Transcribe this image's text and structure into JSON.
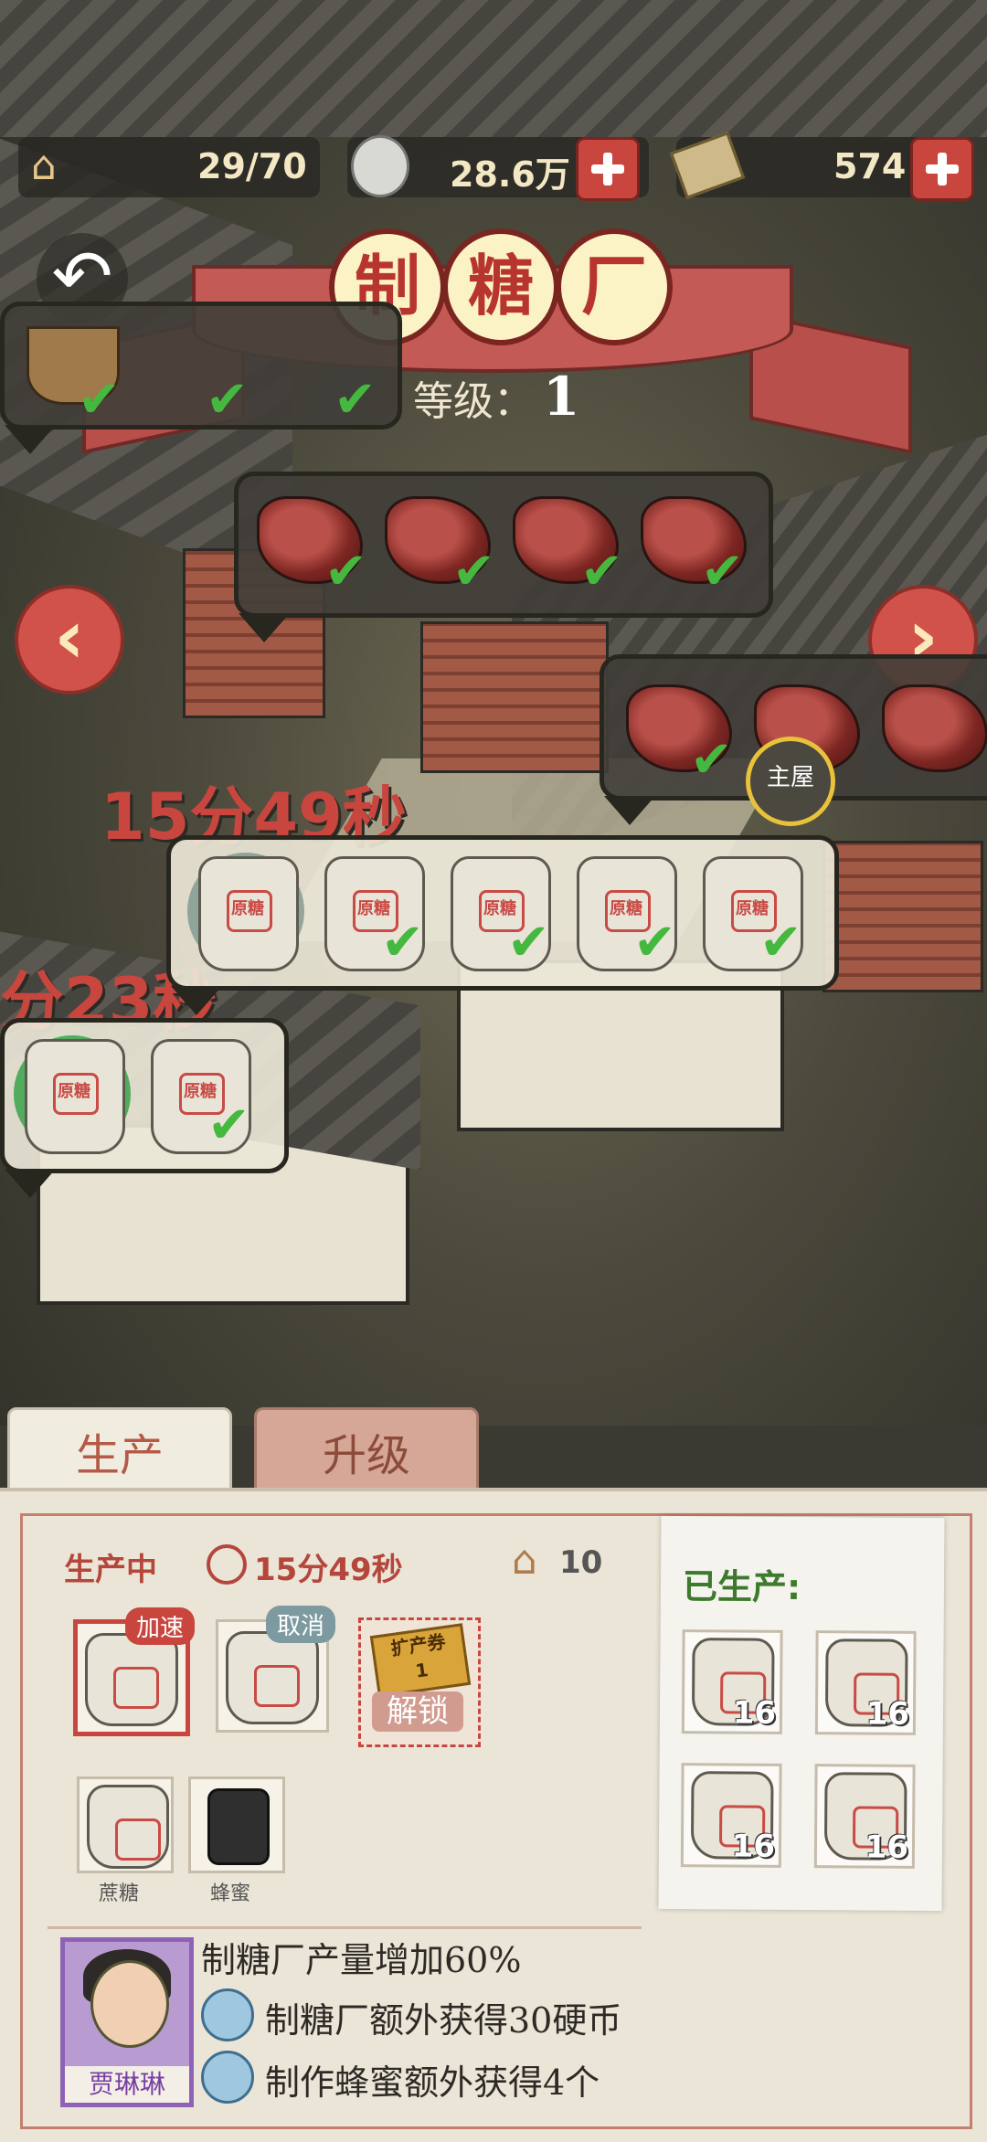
{
  "hud": {
    "energy": "29/70",
    "coins": "28.6万",
    "cash": "574"
  },
  "building": {
    "title_chars": [
      "制",
      "糖",
      "厂"
    ],
    "level_label": "等级：",
    "level_value": "1"
  },
  "map": {
    "timer_main": "15分49秒",
    "timer_left": "分23秒",
    "main_house_label": "主屋",
    "sack_label": "原糖"
  },
  "tabs": {
    "production": "生产",
    "upgrade": "升级"
  },
  "production": {
    "status_label": "生产中",
    "time_left": "15分49秒",
    "energy_cost": "10",
    "speedup_label": "加速",
    "cancel_label": "取消",
    "expand_ticket_label": "扩产券",
    "expand_ticket_count": "1",
    "unlock_label": "解锁",
    "recipes": [
      {
        "name": "蔗糖",
        "icon": "sugar-sack-icon"
      },
      {
        "name": "蜂蜜",
        "icon": "honey-jar-icon"
      }
    ]
  },
  "produced": {
    "title": "已生产:",
    "items": [
      {
        "count": "16",
        "icon": "sugar-sack-icon"
      },
      {
        "count": "16",
        "icon": "sugar-sack-icon"
      },
      {
        "count": "16",
        "icon": "sugar-sack-icon"
      },
      {
        "count": "16",
        "icon": "sugar-sack-icon"
      }
    ]
  },
  "manager": {
    "name": "贾琳琳",
    "bonuses": [
      "制糖厂产量增加60%",
      "制糖厂额外获得30硬币",
      "制作蜂蜜额外获得4个"
    ]
  },
  "colors": {
    "accent_red": "#c9463f",
    "panel_bg": "#ebe5d7",
    "produced_green": "#3e7a2e",
    "check_green": "#45b83f"
  }
}
